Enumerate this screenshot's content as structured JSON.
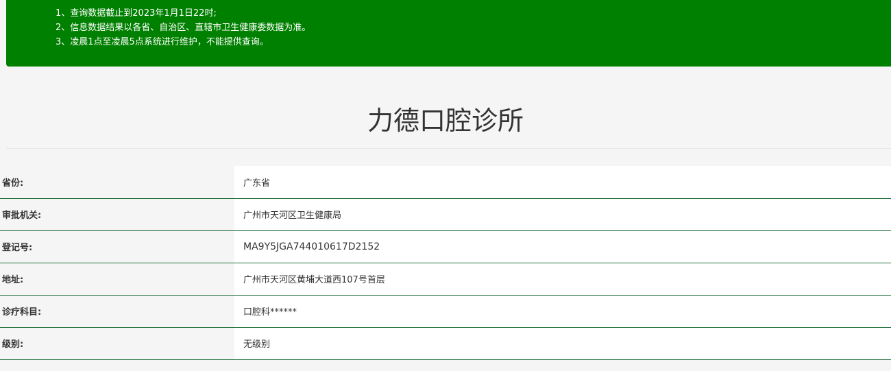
{
  "notice": {
    "lines": [
      "1、查询数据截止到2023年1月1日22时;",
      "2、信息数据结果以各省、自治区、直辖市卫生健康委数据为准。",
      "3、凌晨1点至凌晨5点系统进行维护，不能提供查询。"
    ]
  },
  "title": "力德口腔诊所",
  "rows": [
    {
      "label": "省份:",
      "value": "广东省"
    },
    {
      "label": "审批机关:",
      "value": "广州市天河区卫生健康局"
    },
    {
      "label": "登记号:",
      "value": "MA9Y5JGA744010617D2152"
    },
    {
      "label": "地址:",
      "value": "广州市天河区黄埔大道西107号首层"
    },
    {
      "label": "诊疗科目:",
      "value": "口腔科******"
    },
    {
      "label": "级别:",
      "value": "无级别"
    }
  ],
  "colors": {
    "notice_bg": "#008000",
    "row_border": "#1f6f3a",
    "page_bg": "#f5f5f5"
  }
}
